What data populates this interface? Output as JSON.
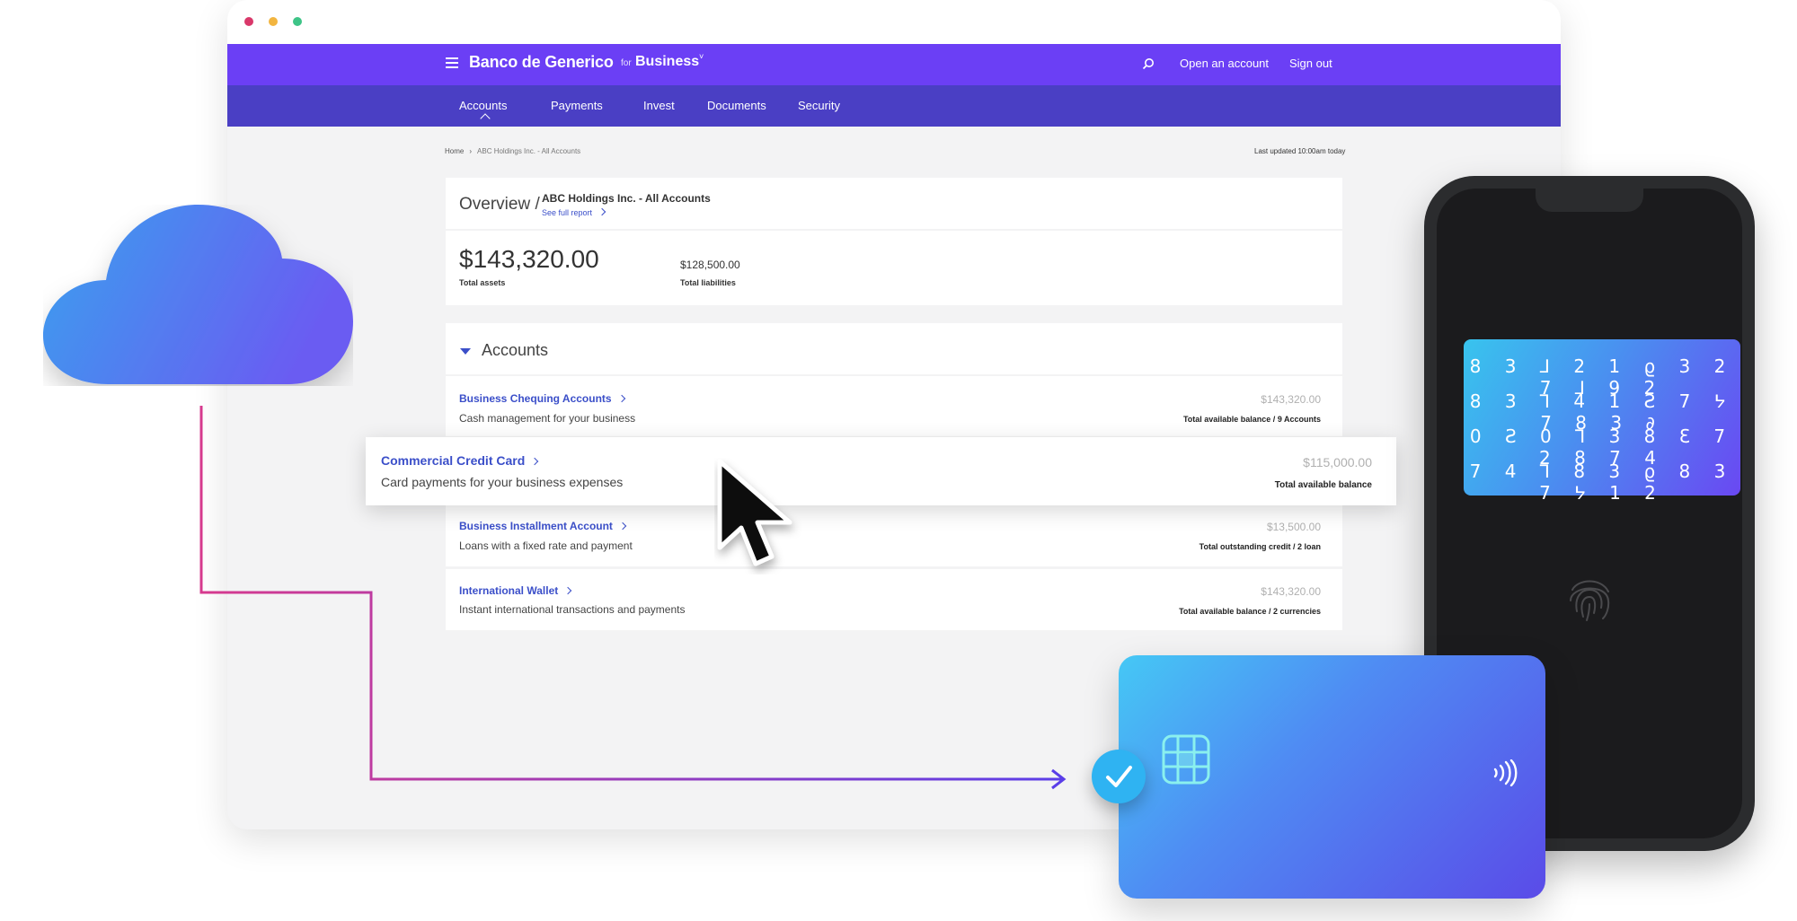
{
  "window": {
    "traffic_lights": [
      "#d9386a",
      "#f2b540",
      "#3ec487"
    ]
  },
  "header": {
    "brand": "Banco de Generico",
    "for_label": "for",
    "business_label": "Business",
    "business_caret": "˅",
    "search_icon": "search-icon",
    "open_account": "Open an account",
    "sign_out": "Sign out",
    "brand_color": "#6b3ff5"
  },
  "subnav": {
    "items": [
      {
        "label": "Accounts"
      },
      {
        "label": "Payments"
      },
      {
        "label": "Invest"
      },
      {
        "label": "Documents"
      },
      {
        "label": "Security"
      }
    ],
    "active": "Accounts",
    "color": "#4a3fc4"
  },
  "breadcrumb": {
    "home": "Home",
    "current": "ABC Holdings Inc. - All Accounts"
  },
  "last_updated": "Last updated 10:00am today",
  "overview": {
    "title": "Overview /",
    "subtitle": "ABC Holdings Inc. - All Accounts",
    "link": "See full report",
    "total_assets": "$143,320.00",
    "total_assets_label": "Total assets",
    "total_liabilities": "$128,500.00",
    "total_liabilities_label": "Total liabilities"
  },
  "accounts": {
    "heading": "Accounts",
    "rows": [
      {
        "title": "Business Chequing Accounts",
        "desc": "Cash management for your business",
        "amount": "$143,320.00",
        "meta": "Total available balance  /  9 Accounts"
      },
      {
        "title": "Commercial Credit Card",
        "desc": "Card payments for your business expenses",
        "amount": "$115,000.00",
        "meta": "Total available balance"
      },
      {
        "title": "Business Installment Account",
        "desc": "Loans with a fixed rate and payment",
        "amount": "$13,500.00",
        "meta": "Total outstanding credit / 2 loan"
      },
      {
        "title": "International Wallet",
        "desc": "Instant international transactions and payments",
        "amount": "$143,320.00",
        "meta": "Total available balance  /  2 currencies"
      }
    ]
  },
  "phone": {
    "code_rows": [
      "8 3 ⅃ 2 1 ϱ 3 2 7 ⅃ 9 2",
      "8 3 ⅂ 4 1 Ƨ 7 ᔭ 7 8 3 ∂",
      "0 Ƨ 0 ⅂ 3 8 Ɛ 7 2 8 7 4",
      "7 4 ⅂ 8 3 ϱ 8 3 7 ᔭ 1 2"
    ],
    "fingerprint_icon": "fingerprint-icon"
  },
  "card": {
    "chip_icon": "chip-icon",
    "contactless_icon": "contactless-icon"
  },
  "decor": {
    "cloud_icon": "cloud-icon",
    "check_icon": "check-icon",
    "cursor_icon": "cursor-icon"
  }
}
